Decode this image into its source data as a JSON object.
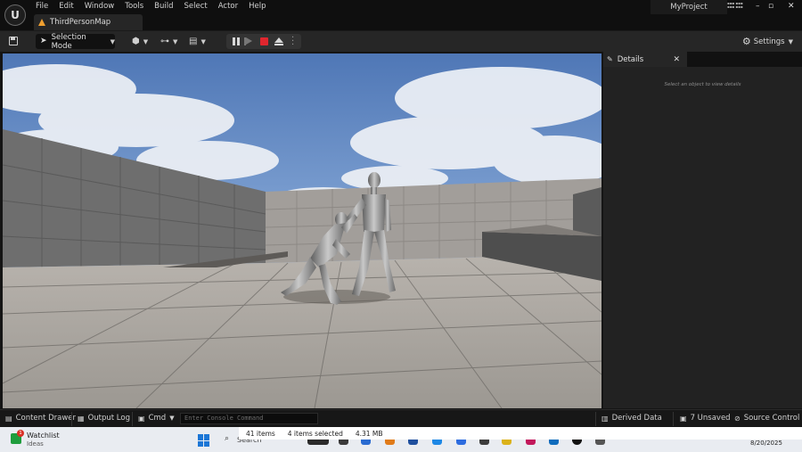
{
  "menu": [
    "File",
    "Edit",
    "Window",
    "Tools",
    "Build",
    "Select",
    "Actor",
    "Help"
  ],
  "level_tab": "ThirdPersonMap",
  "project_name": "MyProject",
  "toolbar": {
    "mode_label": "Selection Mode",
    "settings_label": "Settings"
  },
  "details": {
    "title": "Details",
    "empty_message": "Select an object to view details"
  },
  "statusbar": {
    "content_drawer": "Content Drawer",
    "output_log": "Output Log",
    "cmd": "Cmd",
    "console_placeholder": "Enter Console Command",
    "derived_data": "Derived Data",
    "unsaved": "7 Unsaved",
    "source_control": "Source Control"
  },
  "tooltip": {
    "items": "41 items",
    "selected": "4 items selected",
    "size": "4.31 MB"
  },
  "taskbar": {
    "widget_title": "Watchlist",
    "widget_subtitle": "Ideas",
    "widget_badge": "1",
    "search": "Search",
    "date": "8/20/2025"
  },
  "colors": {
    "stop": "#e0262e",
    "accent_orange": "#f0a030",
    "sky": "#5f84c2"
  },
  "icons": {
    "engine_logo": "unreal-logo-icon",
    "save": "save-icon",
    "viewport_tools": [
      "camera-icon",
      "video-camera-icon",
      "screens-icon",
      "gear-icon"
    ]
  }
}
